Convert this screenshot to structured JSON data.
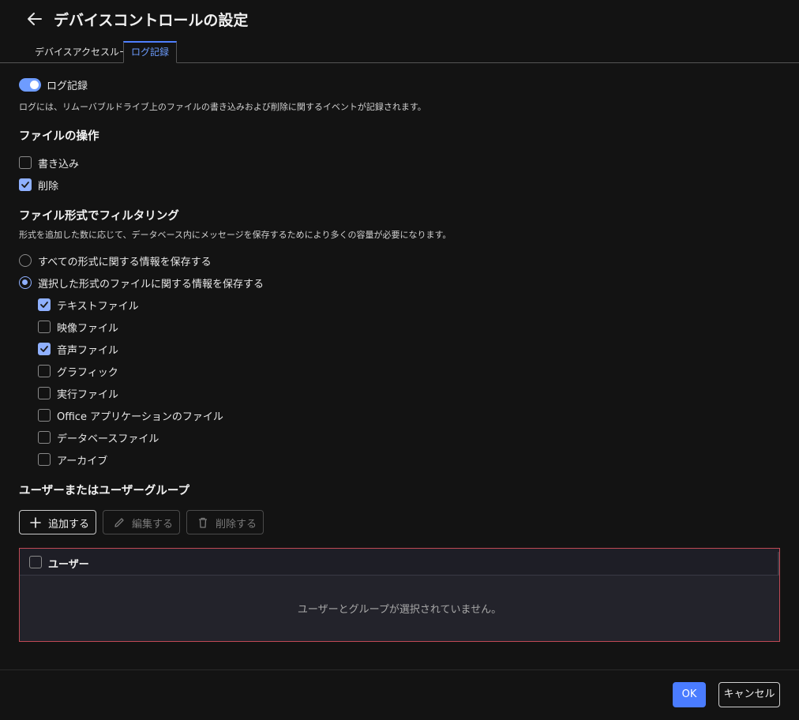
{
  "header": {
    "title": "デバイスコントロールの設定",
    "back_icon": "arrow-left-icon"
  },
  "tabs": [
    {
      "label": "デバイスアクセスルール",
      "active": false
    },
    {
      "label": "ログ記録",
      "active": true
    }
  ],
  "logging": {
    "toggle_label": "ログ記録",
    "toggle_on": true,
    "description": "ログには、リムーバブルドライブ上のファイルの書き込みおよび削除に関するイベントが記録されます。"
  },
  "file_ops": {
    "title": "ファイルの操作",
    "items": [
      {
        "label": "書き込み",
        "checked": false
      },
      {
        "label": "削除",
        "checked": true
      }
    ]
  },
  "filter": {
    "title": "ファイル形式でフィルタリング",
    "description": "形式を追加した数に応じて、データベース内にメッセージを保存するためにより多くの容量が必要になります。",
    "radios": [
      {
        "label": "すべての形式に関する情報を保存する",
        "selected": false
      },
      {
        "label": "選択した形式のファイルに関する情報を保存する",
        "selected": true
      }
    ],
    "types": [
      {
        "label": "テキストファイル",
        "checked": true
      },
      {
        "label": "映像ファイル",
        "checked": false
      },
      {
        "label": "音声ファイル",
        "checked": true
      },
      {
        "label": "グラフィック",
        "checked": false
      },
      {
        "label": "実行ファイル",
        "checked": false
      },
      {
        "label": "Office アプリケーションのファイル",
        "checked": false
      },
      {
        "label": "データベースファイル",
        "checked": false
      },
      {
        "label": "アーカイブ",
        "checked": false
      }
    ]
  },
  "users": {
    "title": "ユーザーまたはユーザーグループ",
    "add_label": "追加する",
    "edit_label": "編集する",
    "delete_label": "削除する",
    "column_header": "ユーザー",
    "empty_message": "ユーザーとグループが選択されていません。"
  },
  "footer": {
    "ok_label": "OK",
    "cancel_label": "キャンセル"
  },
  "colors": {
    "accent": "#4a7cff",
    "checkbox": "#8fb0ff",
    "error_border": "#c04a55"
  }
}
